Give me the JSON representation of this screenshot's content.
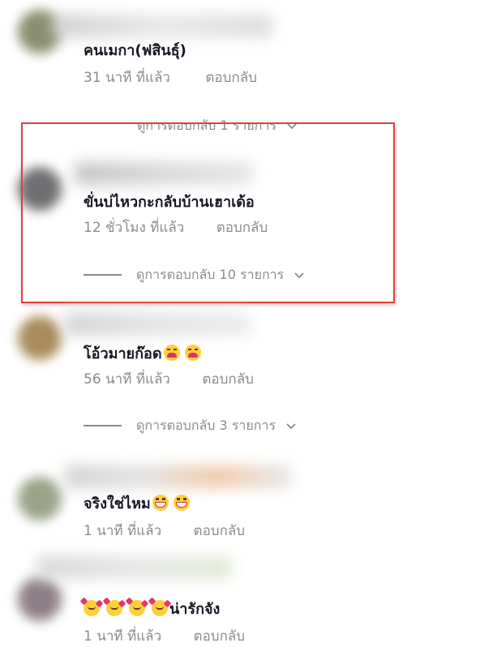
{
  "comments": [
    {
      "text": "คนเมกา(ฟสินธุ์)",
      "time": "31 นาที ที่แล้ว",
      "reply": "ตอบกลับ",
      "view_replies": "ดูการตอบกลับ 1 รายการ",
      "avatar_color": "#8b8f6e",
      "emojis": []
    },
    {
      "text": "ขั่นบ่ไหวกะกลับบ้านเฮาเด้อ",
      "time": "12 ชั่วโมง ที่แล้ว",
      "reply": "ตอบกลับ",
      "view_replies": "ดูการตอบกลับ 10 รายการ",
      "avatar_color": "#6f6f72",
      "emojis": []
    },
    {
      "text": "โอ้วมายก๊อด",
      "time": "56 นาที ที่แล้ว",
      "reply": "ตอบกลับ",
      "view_replies": "ดูการตอบกลับ 3 รายการ",
      "avatar_color": "#a88c5c",
      "emojis": [
        "weary-face-emoji",
        "weary-face-emoji"
      ]
    },
    {
      "text": "จริงใช่ไหม",
      "time": "1 นาที ที่แล้ว",
      "reply": "ตอบกลับ",
      "avatar_color": "#9aa487",
      "emojis": [
        "grinning-face-emoji",
        "grinning-face-emoji"
      ]
    },
    {
      "text": "น่ารักจัง",
      "time": "1 นาที ที่แล้ว",
      "reply": "ตอบกลับ",
      "avatar_color": "#8e7f86",
      "emojis": [
        "smiling-face-with-hearts-emoji",
        "smiling-face-with-hearts-emoji",
        "smiling-face-with-hearts-emoji",
        "smiling-face-with-hearts-emoji"
      ]
    }
  ],
  "colors": {
    "text_primary": "#161823",
    "text_secondary": "#8a8b91",
    "highlight_border": "#e0413a"
  },
  "icons": {
    "chevron": "chevron-down-icon"
  }
}
